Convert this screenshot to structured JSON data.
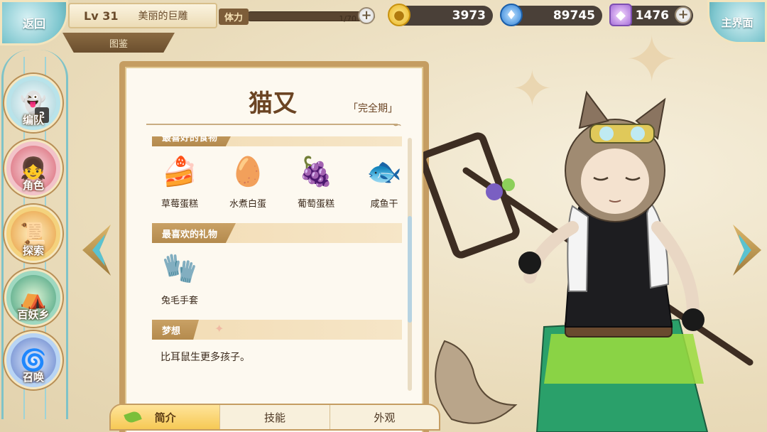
{
  "topbar": {
    "back_label": "返回",
    "level": "Lv 31",
    "player_name": "美丽的巨雕",
    "section_tab": "图鉴",
    "stamina": {
      "label": "体力",
      "value_text": "1/70",
      "fill_fraction": 0.014
    },
    "gold": "3973",
    "soul_fire": "89745",
    "gems": "1476",
    "home_label": "主界面"
  },
  "sidebar": {
    "items": [
      {
        "label": "编队",
        "badge": "2",
        "icon": "ghost-icon"
      },
      {
        "label": "角色",
        "icon": "character-icon"
      },
      {
        "label": "探索",
        "icon": "scroll-icon"
      },
      {
        "label": "百妖乡",
        "icon": "house-icon"
      },
      {
        "label": "召唤",
        "icon": "swirl-icon"
      }
    ]
  },
  "codex": {
    "name": "猫又",
    "stage": "「完全期」",
    "sections": {
      "favorite_food": {
        "title": "最喜好的食物",
        "items": [
          {
            "name": "草莓蛋糕",
            "icon": "strawberry-cake-icon"
          },
          {
            "name": "水煮白蛋",
            "icon": "boiled-egg-icon"
          },
          {
            "name": "葡萄蛋糕",
            "icon": "grape-cake-icon"
          },
          {
            "name": "咸鱼干",
            "icon": "dried-fish-icon"
          }
        ]
      },
      "favorite_gift": {
        "title": "最喜欢的礼物",
        "items": [
          {
            "name": "兔毛手套",
            "icon": "gloves-icon"
          }
        ]
      },
      "dream": {
        "title": "梦想",
        "text": "比耳鼠生更多孩子。"
      }
    }
  },
  "tabs": [
    {
      "label": "简介",
      "active": true
    },
    {
      "label": "技能",
      "active": false
    },
    {
      "label": "外观",
      "active": false
    }
  ],
  "colors": {
    "accent_teal": "#7fc7cf",
    "panel_brown": "#c59d62",
    "title_brown": "#6b4423",
    "tab_active": "#f6c955"
  }
}
